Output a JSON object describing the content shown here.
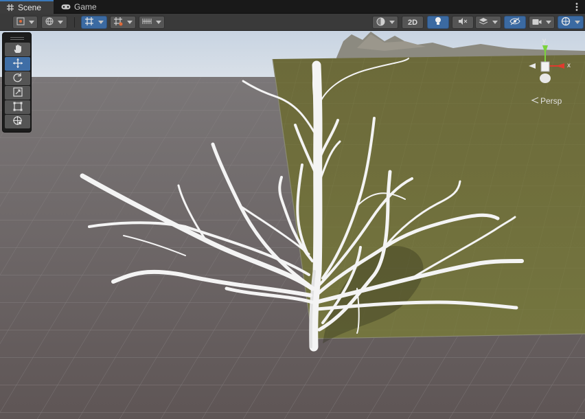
{
  "tabs": [
    {
      "label": "Scene",
      "icon": "grid-icon",
      "active": true
    },
    {
      "label": "Game",
      "icon": "gamepad-icon",
      "active": false
    }
  ],
  "toolbar": {
    "toggle_2d_label": "2D",
    "accent_color": "#3b6aa2"
  },
  "viewport": {
    "projection_label": "Persp",
    "gizmo_axes": {
      "x": "x",
      "y": "y"
    },
    "floor_color": "#686060",
    "terrain_color": "#6e6f3e"
  },
  "tools": [
    {
      "name": "hand-tool",
      "icon": "hand-icon",
      "active": false
    },
    {
      "name": "move-tool",
      "icon": "move-arrows-icon",
      "active": true
    },
    {
      "name": "rotate-tool",
      "icon": "rotate-icon",
      "active": false
    },
    {
      "name": "scale-tool",
      "icon": "scale-icon",
      "active": false
    },
    {
      "name": "rect-tool",
      "icon": "rect-transform-icon",
      "active": false
    },
    {
      "name": "transform-tool",
      "icon": "transform-icon",
      "active": false
    }
  ]
}
